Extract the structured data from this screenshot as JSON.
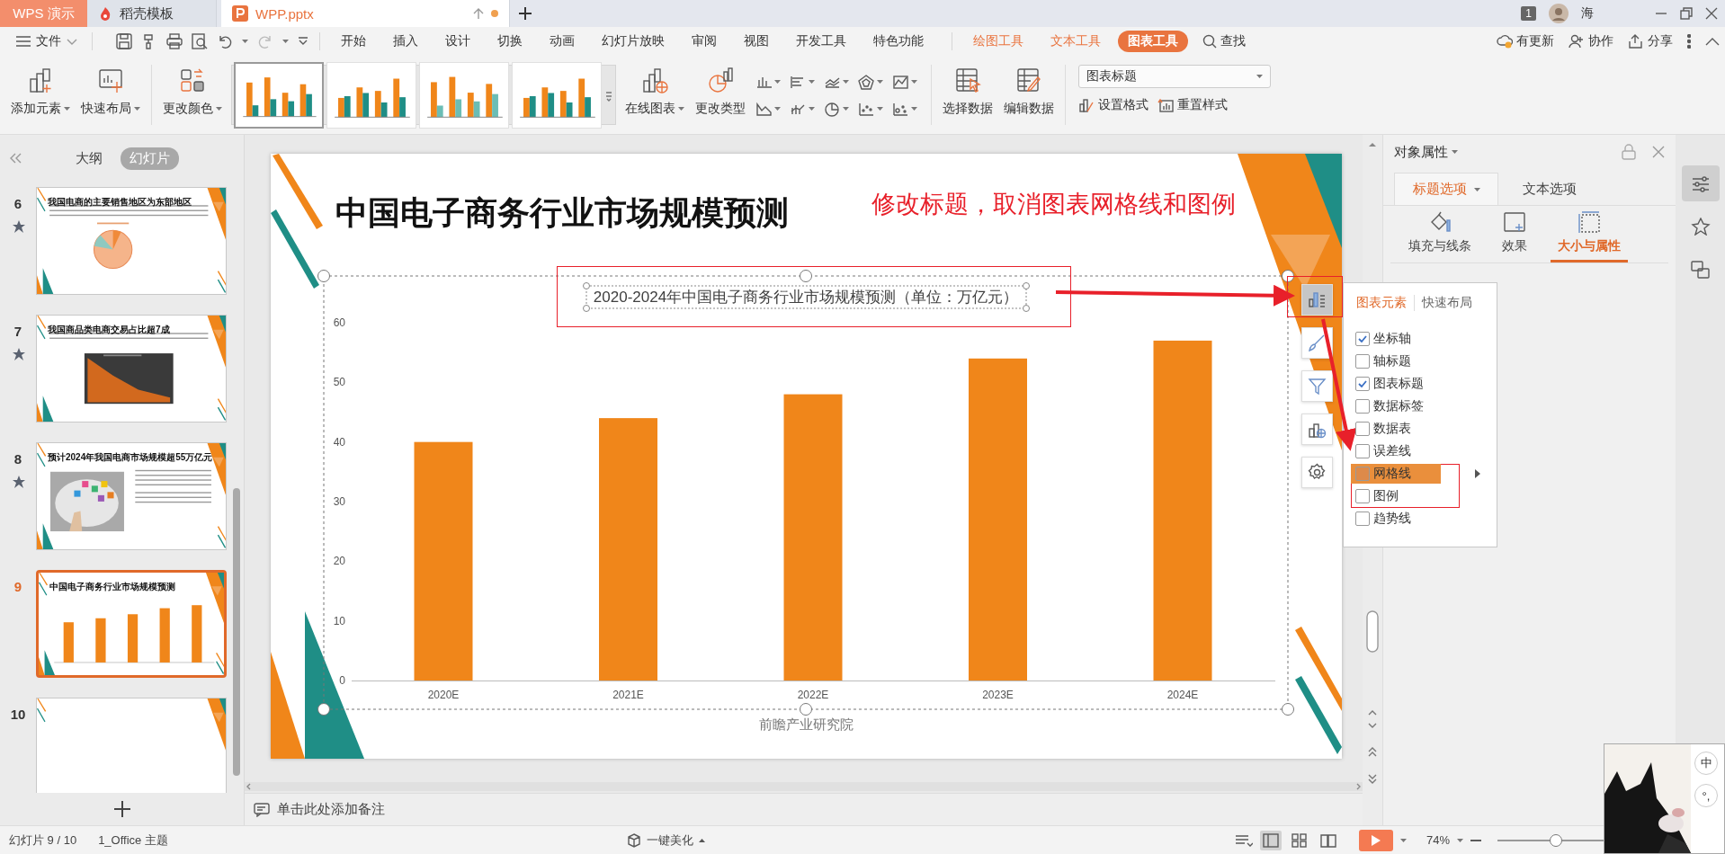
{
  "app_button": "WPS 演示",
  "doc_tabs": [
    {
      "label": "稻壳模板",
      "kind": "docer",
      "selected": false,
      "unsaved": false
    },
    {
      "label": "WPP.pptx",
      "kind": "presentation",
      "selected": true,
      "unsaved": true
    }
  ],
  "account": {
    "badge": "1",
    "name": "海"
  },
  "menu": {
    "file": "文件",
    "tabs": [
      {
        "label": "开始",
        "kind": "main",
        "selected": false
      },
      {
        "label": "插入",
        "kind": "main",
        "selected": false
      },
      {
        "label": "设计",
        "kind": "main",
        "selected": false
      },
      {
        "label": "切换",
        "kind": "main",
        "selected": false
      },
      {
        "label": "动画",
        "kind": "main",
        "selected": false
      },
      {
        "label": "幻灯片放映",
        "kind": "main",
        "selected": false
      },
      {
        "label": "审阅",
        "kind": "main",
        "selected": false
      },
      {
        "label": "视图",
        "kind": "main",
        "selected": false
      },
      {
        "label": "开发工具",
        "kind": "main",
        "selected": false
      },
      {
        "label": "特色功能",
        "kind": "main",
        "selected": false
      },
      {
        "label": "绘图工具",
        "kind": "context",
        "selected": false
      },
      {
        "label": "文本工具",
        "kind": "context",
        "selected": false
      },
      {
        "label": "图表工具",
        "kind": "context",
        "selected": true
      }
    ],
    "search": "查找",
    "actions": [
      {
        "label": "有更新",
        "kind": "update"
      },
      {
        "label": "协作",
        "kind": "collab"
      },
      {
        "label": "分享",
        "kind": "share"
      }
    ]
  },
  "ribbon": {
    "left": [
      {
        "label": "添加元素",
        "kind": "add",
        "dropdown": true
      },
      {
        "label": "快速布局",
        "kind": "layout",
        "dropdown": true
      },
      {
        "label": "更改颜色",
        "kind": "color",
        "dropdown": true
      }
    ],
    "styles": [
      {
        "selected": true
      },
      {
        "selected": false
      },
      {
        "selected": false
      },
      {
        "selected": false
      }
    ],
    "chart_buttons": [
      {
        "label": "在线图表",
        "kind": "online",
        "dropdown": true
      },
      {
        "label": "更改类型",
        "kind": "type",
        "dropdown": false
      }
    ],
    "data_buttons": [
      {
        "label": "选择数据",
        "kind": "select",
        "dropdown": false
      },
      {
        "label": "编辑数据",
        "kind": "edit",
        "dropdown": false
      }
    ],
    "element_select": {
      "value": "图表标题"
    },
    "format_buttons": [
      {
        "label": "设置格式",
        "kind": "format"
      },
      {
        "label": "重置样式",
        "kind": "reset"
      }
    ]
  },
  "slide_panel": {
    "tabs": [
      {
        "label": "大纲",
        "selected": false
      },
      {
        "label": "幻灯片",
        "selected": true
      }
    ],
    "slides": [
      {
        "number": "6",
        "title": "我国电商的主要销售地区为东部地区",
        "kind": "pie",
        "animated": true,
        "selected": false
      },
      {
        "number": "7",
        "title": "我国商品类电商交易占比超7成",
        "kind": "area",
        "animated": true,
        "selected": false
      },
      {
        "number": "8",
        "title": "预计2024年我国电商市场规模超55万亿元",
        "kind": "picture",
        "animated": true,
        "selected": false
      },
      {
        "number": "9",
        "title": "中国电子商务行业市场规模预测",
        "kind": "bar",
        "animated": false,
        "selected": true
      },
      {
        "number": "10",
        "kind": "blank",
        "animated": false,
        "selected": false
      }
    ]
  },
  "slide": {
    "title": "中国电子商务行业市场规模预测",
    "annotation": "修改标题，取消图表网格线和图例",
    "chart": {
      "chart_data": {
        "type": "bar",
        "title": "2020-2024年中国电子商务行业市场规模预测（单位：万亿元）",
        "categories": [
          "2020E",
          "2021E",
          "2022E",
          "2023E",
          "2024E"
        ],
        "values": [
          40,
          44,
          48,
          54,
          57
        ],
        "ylim": [
          0,
          60
        ],
        "yticks": [
          0,
          10,
          20,
          30,
          40,
          50,
          60
        ]
      }
    },
    "source": "前瞻产业研究院"
  },
  "chart_tools": [
    {
      "kind": "elements",
      "selected": true
    },
    {
      "kind": "style",
      "selected": false
    },
    {
      "kind": "filter",
      "selected": false
    },
    {
      "kind": "online",
      "selected": false
    },
    {
      "kind": "settings",
      "selected": false
    }
  ],
  "chart_elements_popup": {
    "tabs": [
      {
        "label": "图表元素",
        "selected": true
      },
      {
        "label": "快速布局",
        "selected": false
      }
    ],
    "items": [
      {
        "label": "坐标轴",
        "checked": true,
        "highlighted": false,
        "submenu": false
      },
      {
        "label": "轴标题",
        "checked": false,
        "highlighted": false,
        "submenu": false
      },
      {
        "label": "图表标题",
        "checked": true,
        "highlighted": false,
        "submenu": false
      },
      {
        "label": "数据标签",
        "checked": false,
        "highlighted": false,
        "submenu": false
      },
      {
        "label": "数据表",
        "checked": false,
        "highlighted": false,
        "submenu": false
      },
      {
        "label": "误差线",
        "checked": false,
        "highlighted": false,
        "submenu": false
      },
      {
        "label": "网格线",
        "checked": false,
        "highlighted": true,
        "submenu": true
      },
      {
        "label": "图例",
        "checked": false,
        "highlighted": false,
        "submenu": false
      },
      {
        "label": "趋势线",
        "checked": false,
        "highlighted": false,
        "submenu": false
      }
    ]
  },
  "properties": {
    "title": "对象属性",
    "tabs": [
      {
        "label": "标题选项",
        "selected": true,
        "dropdown": true
      },
      {
        "label": "文本选项",
        "selected": false,
        "dropdown": false
      }
    ],
    "sections": [
      {
        "label": "填充与线条",
        "kind": "fill",
        "selected": false
      },
      {
        "label": "效果",
        "kind": "effects",
        "selected": false
      },
      {
        "label": "大小与属性",
        "kind": "size",
        "selected": true
      }
    ]
  },
  "side_tools": [
    {
      "kind": "properties",
      "selected": true
    },
    {
      "kind": "animation",
      "selected": false
    },
    {
      "kind": "transition",
      "selected": false
    }
  ],
  "notes": {
    "placeholder": "单击此处添加备注"
  },
  "status_bar": {
    "slide_counter": "幻灯片 9 / 10",
    "theme": "1_Office 主题",
    "beautify": "一键美化",
    "views": [
      {
        "kind": "normal",
        "selected": true
      },
      {
        "kind": "sorter",
        "selected": false
      },
      {
        "kind": "reading",
        "selected": false
      }
    ],
    "zoom": "74%",
    "zoom_slider": {
      "level": 0.55
    }
  },
  "ime": {
    "mode": "中",
    "punctuation": "°,"
  }
}
